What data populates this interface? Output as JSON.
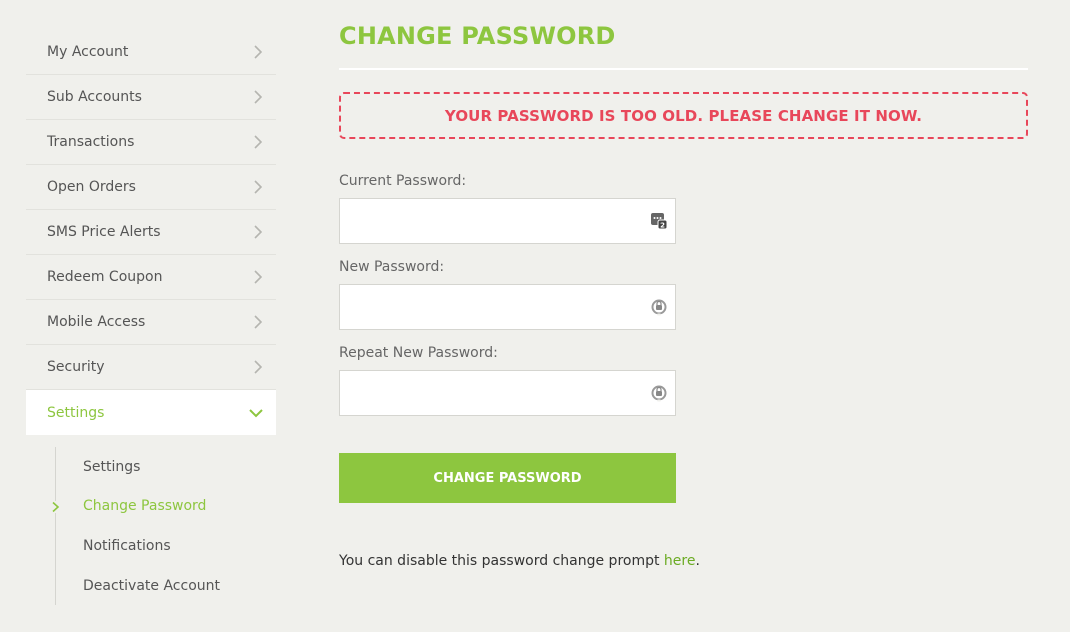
{
  "sidebar": {
    "items": [
      {
        "label": "My Account"
      },
      {
        "label": "Sub Accounts"
      },
      {
        "label": "Transactions"
      },
      {
        "label": "Open Orders"
      },
      {
        "label": "SMS Price Alerts"
      },
      {
        "label": "Redeem Coupon"
      },
      {
        "label": "Mobile Access"
      },
      {
        "label": "Security"
      },
      {
        "label": "Settings",
        "active": true
      }
    ],
    "subitems": [
      {
        "label": "Settings"
      },
      {
        "label": "Change Password",
        "active": true
      },
      {
        "label": "Notifications"
      },
      {
        "label": "Deactivate Account"
      }
    ]
  },
  "main": {
    "title": "CHANGE PASSWORD",
    "alert": "YOUR PASSWORD IS TOO OLD. PLEASE CHANGE IT NOW.",
    "fields": {
      "current_label": "Current Password:",
      "current_value": "",
      "new_label": "New Password:",
      "new_value": "",
      "repeat_label": "Repeat New Password:",
      "repeat_value": ""
    },
    "submit_label": "CHANGE PASSWORD",
    "note_prefix": "You can disable this password change prompt ",
    "note_link": "here",
    "note_suffix": "."
  },
  "colors": {
    "accent": "#8dc63f",
    "alert": "#e8475a",
    "background": "#f0f0ec"
  },
  "icons": {
    "nav_chevron": "chevron-right-icon",
    "active_chevron": "chevron-down-icon",
    "current_field": "password-manager-icon",
    "new_field": "key-icon",
    "repeat_field": "key-icon"
  }
}
